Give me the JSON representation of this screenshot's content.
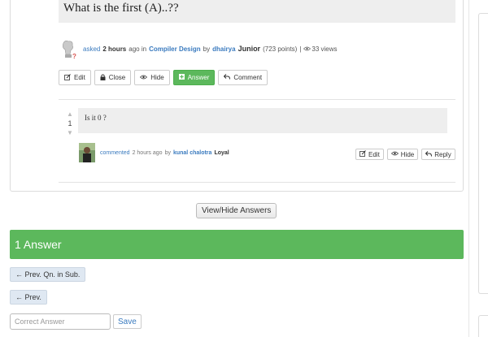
{
  "question": {
    "title": "What is the first (A)..??",
    "meta": {
      "action": "asked",
      "time": "2 hours",
      "ago_in": "ago in",
      "category": "Compiler Design",
      "by": "by",
      "user": "dhairya",
      "rank": "Junior",
      "points": "(723 points)",
      "separator": "|",
      "views": "33 views"
    },
    "buttons": [
      {
        "label": "Edit",
        "icon": "edit-icon"
      },
      {
        "label": "Close",
        "icon": "lock-icon"
      },
      {
        "label": "Hide",
        "icon": "eye-icon"
      },
      {
        "label": "Answer",
        "icon": "plus-square-icon"
      },
      {
        "label": "Comment",
        "icon": "reply-icon"
      }
    ]
  },
  "comment": {
    "text": "Is it 0 ?",
    "votes": "1",
    "meta": {
      "action": "commented",
      "time": "2 hours ago",
      "by": "by",
      "user": "kunal chalotra",
      "rank": "Loyal"
    },
    "buttons": [
      {
        "label": "Edit",
        "icon": "edit-icon"
      },
      {
        "label": "Hide",
        "icon": "eye-icon"
      },
      {
        "label": "Reply",
        "icon": "reply-icon"
      }
    ]
  },
  "view_hide_label": "View/Hide Answers",
  "answers_header": "1 Answer",
  "nav": {
    "prev_qn": "← Prev. Qn. in Sub.",
    "prev": "← Prev."
  },
  "answer_form": {
    "placeholder": "Correct Answer",
    "save_label": "Save"
  },
  "colors": {
    "accent_green": "#5cb85c",
    "link_blue": "#3b7bbf"
  }
}
